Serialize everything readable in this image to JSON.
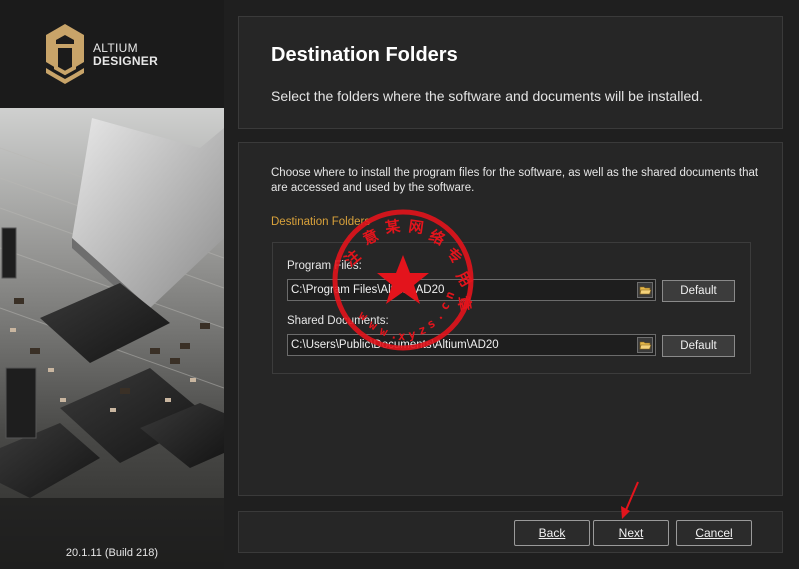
{
  "branding": {
    "line1": "ALTIUM",
    "line2": "DESIGNER",
    "version": "20.1.11 (Build 218)"
  },
  "header": {
    "title": "Destination Folders",
    "subtitle": "Select the folders where the software and documents will be installed."
  },
  "content": {
    "description": "Choose where to install the program files for the software, as well as the shared documents that are accessed and used by the software.",
    "section_label": "Destination Folders",
    "program_files": {
      "label": "Program Files:",
      "value": "C:\\Program Files\\Altium\\AD20",
      "default_label": "Default"
    },
    "shared_documents": {
      "label": "Shared Documents:",
      "value": "C:\\Users\\Public\\Documents\\Altium\\AD20",
      "default_label": "Default"
    }
  },
  "footer": {
    "back_label": "Back",
    "next_label": "Next",
    "cancel_label": "Cancel"
  },
  "watermark": {
    "text": "注意某网络专用章 www.xyzsyhmei.cn"
  },
  "colors": {
    "accent": "#d9a23b",
    "background": "#1f1f1f",
    "panel": "#262626",
    "stamp": "#e3141c",
    "arrow": "#e3141c"
  },
  "icons": {
    "logo": "altium-logo-icon",
    "browse": "folder-icon",
    "arrow": "red-arrow-icon",
    "stamp": "watermark-stamp"
  }
}
